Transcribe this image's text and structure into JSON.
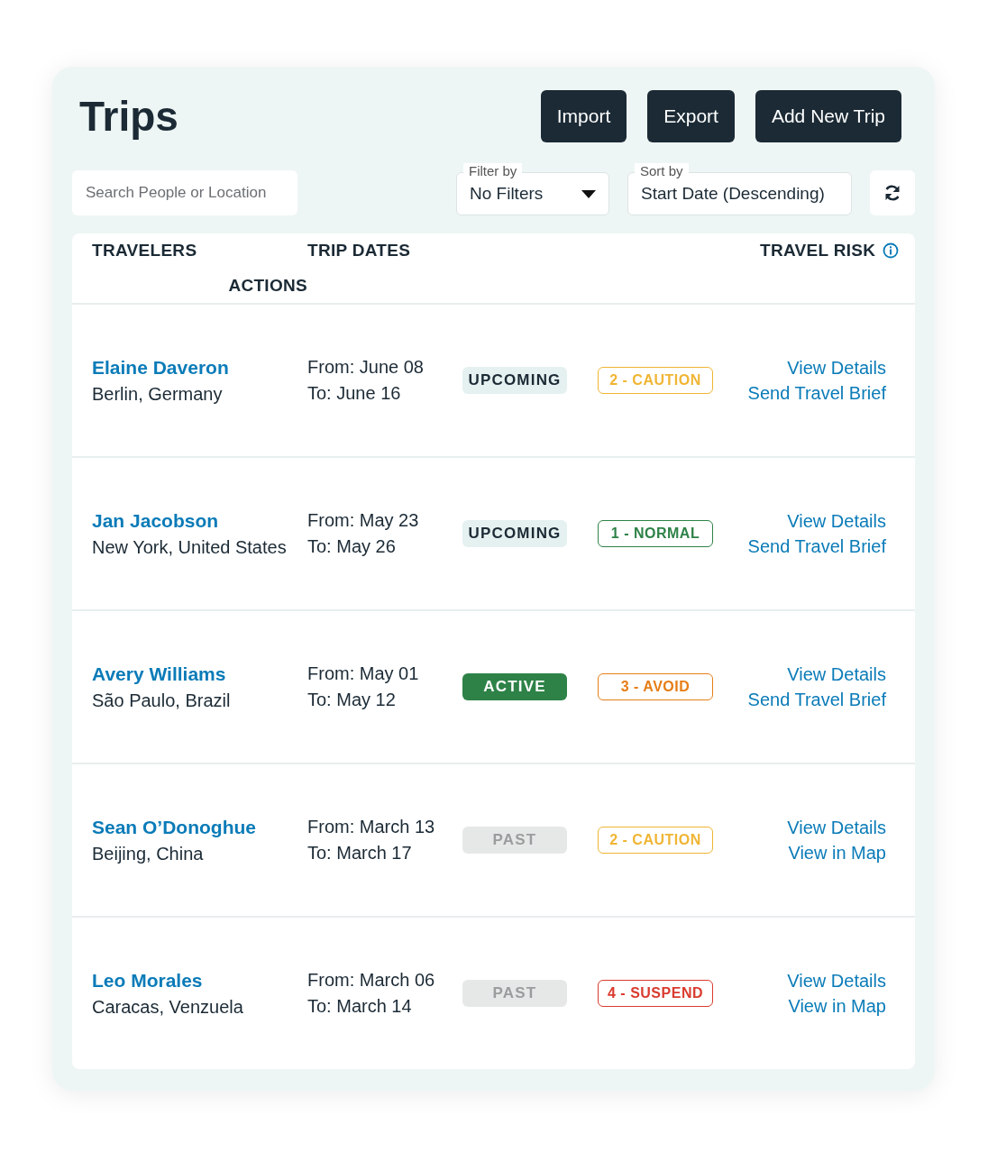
{
  "page": {
    "title": "Trips"
  },
  "buttons": [
    "Import",
    "Export",
    "Add New Trip"
  ],
  "search": {
    "placeholder": "Search People or Location"
  },
  "filter": {
    "label": "Filter by",
    "value": "No Filters"
  },
  "sort": {
    "label": "Sort by",
    "value": "Start Date (Descending)"
  },
  "table": {
    "columns": [
      "TRAVELERS",
      "TRIP DATES",
      "TRAVEL RISK",
      "ACTIONS"
    ],
    "rows": [
      {
        "name": "Elaine Daveron",
        "location": "Berlin, Germany",
        "from": "From: June 08",
        "to": "To: June 16",
        "status": {
          "kind": "upcoming",
          "label": "UPCOMING"
        },
        "risk": {
          "label": "2 - CAUTION",
          "color": "#f0b534"
        },
        "actions": [
          "View Details",
          "Send Travel Brief"
        ]
      },
      {
        "name": "Jan Jacobson",
        "location": "New York, United States",
        "from": "From: May 23",
        "to": "To: May 26",
        "status": {
          "kind": "upcoming",
          "label": "UPCOMING"
        },
        "risk": {
          "label": "1 - NORMAL",
          "color": "#2e8247"
        },
        "actions": [
          "View Details",
          "Send Travel Brief"
        ]
      },
      {
        "name": "Avery Williams",
        "location": "São Paulo, Brazil",
        "from": "From: May 01",
        "to": "To: May 12",
        "status": {
          "kind": "active",
          "label": "ACTIVE"
        },
        "risk": {
          "label": "3 - AVOID",
          "color": "#e67e17"
        },
        "actions": [
          "View Details",
          "Send Travel Brief"
        ]
      },
      {
        "name": "Sean O’Donoghue",
        "location": "Beijing, China",
        "from": "From: March 13",
        "to": "To: March 17",
        "status": {
          "kind": "past",
          "label": "PAST"
        },
        "risk": {
          "label": "2 - CAUTION",
          "color": "#f0b534"
        },
        "actions": [
          "View Details",
          "View in Map"
        ]
      },
      {
        "name": "Leo Morales",
        "location": "Caracas, Venzuela",
        "from": "From: March 06",
        "to": "To: March 14",
        "status": {
          "kind": "past",
          "label": "PAST"
        },
        "risk": {
          "label": "4 - SUSPEND",
          "color": "#d93b2e"
        },
        "actions": [
          "View Details",
          "View in Map"
        ]
      }
    ]
  }
}
